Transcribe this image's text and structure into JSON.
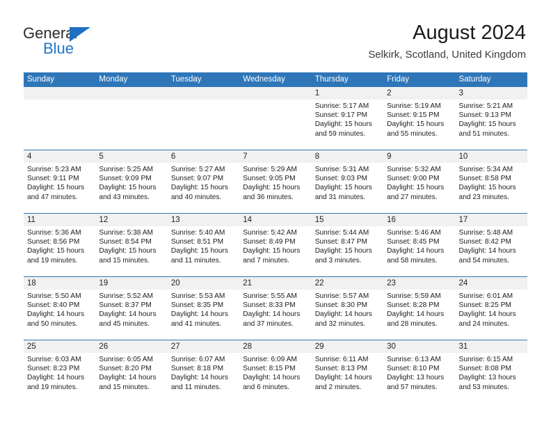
{
  "brand": {
    "name_top": "General",
    "name_bottom": "Blue",
    "icon": "triangle-logo"
  },
  "header": {
    "title": "August 2024",
    "subtitle": "Selkirk, Scotland, United Kingdom"
  },
  "colors": {
    "header_blue": "#2F76B8",
    "brand_blue": "#2277CC",
    "day_band_gray": "#F1F1F1",
    "cell_white": "#FFFFFF"
  },
  "weekday_headers": [
    "Sunday",
    "Monday",
    "Tuesday",
    "Wednesday",
    "Thursday",
    "Friday",
    "Saturday"
  ],
  "weeks": [
    [
      {
        "day": "",
        "empty": true
      },
      {
        "day": "",
        "empty": true
      },
      {
        "day": "",
        "empty": true
      },
      {
        "day": "",
        "empty": true
      },
      {
        "day": "1",
        "sunrise": "Sunrise: 5:17 AM",
        "sunset": "Sunset: 9:17 PM",
        "daylight": "Daylight: 15 hours and 59 minutes."
      },
      {
        "day": "2",
        "sunrise": "Sunrise: 5:19 AM",
        "sunset": "Sunset: 9:15 PM",
        "daylight": "Daylight: 15 hours and 55 minutes."
      },
      {
        "day": "3",
        "sunrise": "Sunrise: 5:21 AM",
        "sunset": "Sunset: 9:13 PM",
        "daylight": "Daylight: 15 hours and 51 minutes."
      }
    ],
    [
      {
        "day": "4",
        "sunrise": "Sunrise: 5:23 AM",
        "sunset": "Sunset: 9:11 PM",
        "daylight": "Daylight: 15 hours and 47 minutes."
      },
      {
        "day": "5",
        "sunrise": "Sunrise: 5:25 AM",
        "sunset": "Sunset: 9:09 PM",
        "daylight": "Daylight: 15 hours and 43 minutes."
      },
      {
        "day": "6",
        "sunrise": "Sunrise: 5:27 AM",
        "sunset": "Sunset: 9:07 PM",
        "daylight": "Daylight: 15 hours and 40 minutes."
      },
      {
        "day": "7",
        "sunrise": "Sunrise: 5:29 AM",
        "sunset": "Sunset: 9:05 PM",
        "daylight": "Daylight: 15 hours and 36 minutes."
      },
      {
        "day": "8",
        "sunrise": "Sunrise: 5:31 AM",
        "sunset": "Sunset: 9:03 PM",
        "daylight": "Daylight: 15 hours and 31 minutes."
      },
      {
        "day": "9",
        "sunrise": "Sunrise: 5:32 AM",
        "sunset": "Sunset: 9:00 PM",
        "daylight": "Daylight: 15 hours and 27 minutes."
      },
      {
        "day": "10",
        "sunrise": "Sunrise: 5:34 AM",
        "sunset": "Sunset: 8:58 PM",
        "daylight": "Daylight: 15 hours and 23 minutes."
      }
    ],
    [
      {
        "day": "11",
        "sunrise": "Sunrise: 5:36 AM",
        "sunset": "Sunset: 8:56 PM",
        "daylight": "Daylight: 15 hours and 19 minutes."
      },
      {
        "day": "12",
        "sunrise": "Sunrise: 5:38 AM",
        "sunset": "Sunset: 8:54 PM",
        "daylight": "Daylight: 15 hours and 15 minutes."
      },
      {
        "day": "13",
        "sunrise": "Sunrise: 5:40 AM",
        "sunset": "Sunset: 8:51 PM",
        "daylight": "Daylight: 15 hours and 11 minutes."
      },
      {
        "day": "14",
        "sunrise": "Sunrise: 5:42 AM",
        "sunset": "Sunset: 8:49 PM",
        "daylight": "Daylight: 15 hours and 7 minutes."
      },
      {
        "day": "15",
        "sunrise": "Sunrise: 5:44 AM",
        "sunset": "Sunset: 8:47 PM",
        "daylight": "Daylight: 15 hours and 3 minutes."
      },
      {
        "day": "16",
        "sunrise": "Sunrise: 5:46 AM",
        "sunset": "Sunset: 8:45 PM",
        "daylight": "Daylight: 14 hours and 58 minutes."
      },
      {
        "day": "17",
        "sunrise": "Sunrise: 5:48 AM",
        "sunset": "Sunset: 8:42 PM",
        "daylight": "Daylight: 14 hours and 54 minutes."
      }
    ],
    [
      {
        "day": "18",
        "sunrise": "Sunrise: 5:50 AM",
        "sunset": "Sunset: 8:40 PM",
        "daylight": "Daylight: 14 hours and 50 minutes."
      },
      {
        "day": "19",
        "sunrise": "Sunrise: 5:52 AM",
        "sunset": "Sunset: 8:37 PM",
        "daylight": "Daylight: 14 hours and 45 minutes."
      },
      {
        "day": "20",
        "sunrise": "Sunrise: 5:53 AM",
        "sunset": "Sunset: 8:35 PM",
        "daylight": "Daylight: 14 hours and 41 minutes."
      },
      {
        "day": "21",
        "sunrise": "Sunrise: 5:55 AM",
        "sunset": "Sunset: 8:33 PM",
        "daylight": "Daylight: 14 hours and 37 minutes."
      },
      {
        "day": "22",
        "sunrise": "Sunrise: 5:57 AM",
        "sunset": "Sunset: 8:30 PM",
        "daylight": "Daylight: 14 hours and 32 minutes."
      },
      {
        "day": "23",
        "sunrise": "Sunrise: 5:59 AM",
        "sunset": "Sunset: 8:28 PM",
        "daylight": "Daylight: 14 hours and 28 minutes."
      },
      {
        "day": "24",
        "sunrise": "Sunrise: 6:01 AM",
        "sunset": "Sunset: 8:25 PM",
        "daylight": "Daylight: 14 hours and 24 minutes."
      }
    ],
    [
      {
        "day": "25",
        "sunrise": "Sunrise: 6:03 AM",
        "sunset": "Sunset: 8:23 PM",
        "daylight": "Daylight: 14 hours and 19 minutes."
      },
      {
        "day": "26",
        "sunrise": "Sunrise: 6:05 AM",
        "sunset": "Sunset: 8:20 PM",
        "daylight": "Daylight: 14 hours and 15 minutes."
      },
      {
        "day": "27",
        "sunrise": "Sunrise: 6:07 AM",
        "sunset": "Sunset: 8:18 PM",
        "daylight": "Daylight: 14 hours and 11 minutes."
      },
      {
        "day": "28",
        "sunrise": "Sunrise: 6:09 AM",
        "sunset": "Sunset: 8:15 PM",
        "daylight": "Daylight: 14 hours and 6 minutes."
      },
      {
        "day": "29",
        "sunrise": "Sunrise: 6:11 AM",
        "sunset": "Sunset: 8:13 PM",
        "daylight": "Daylight: 14 hours and 2 minutes."
      },
      {
        "day": "30",
        "sunrise": "Sunrise: 6:13 AM",
        "sunset": "Sunset: 8:10 PM",
        "daylight": "Daylight: 13 hours and 57 minutes."
      },
      {
        "day": "31",
        "sunrise": "Sunrise: 6:15 AM",
        "sunset": "Sunset: 8:08 PM",
        "daylight": "Daylight: 13 hours and 53 minutes."
      }
    ]
  ]
}
